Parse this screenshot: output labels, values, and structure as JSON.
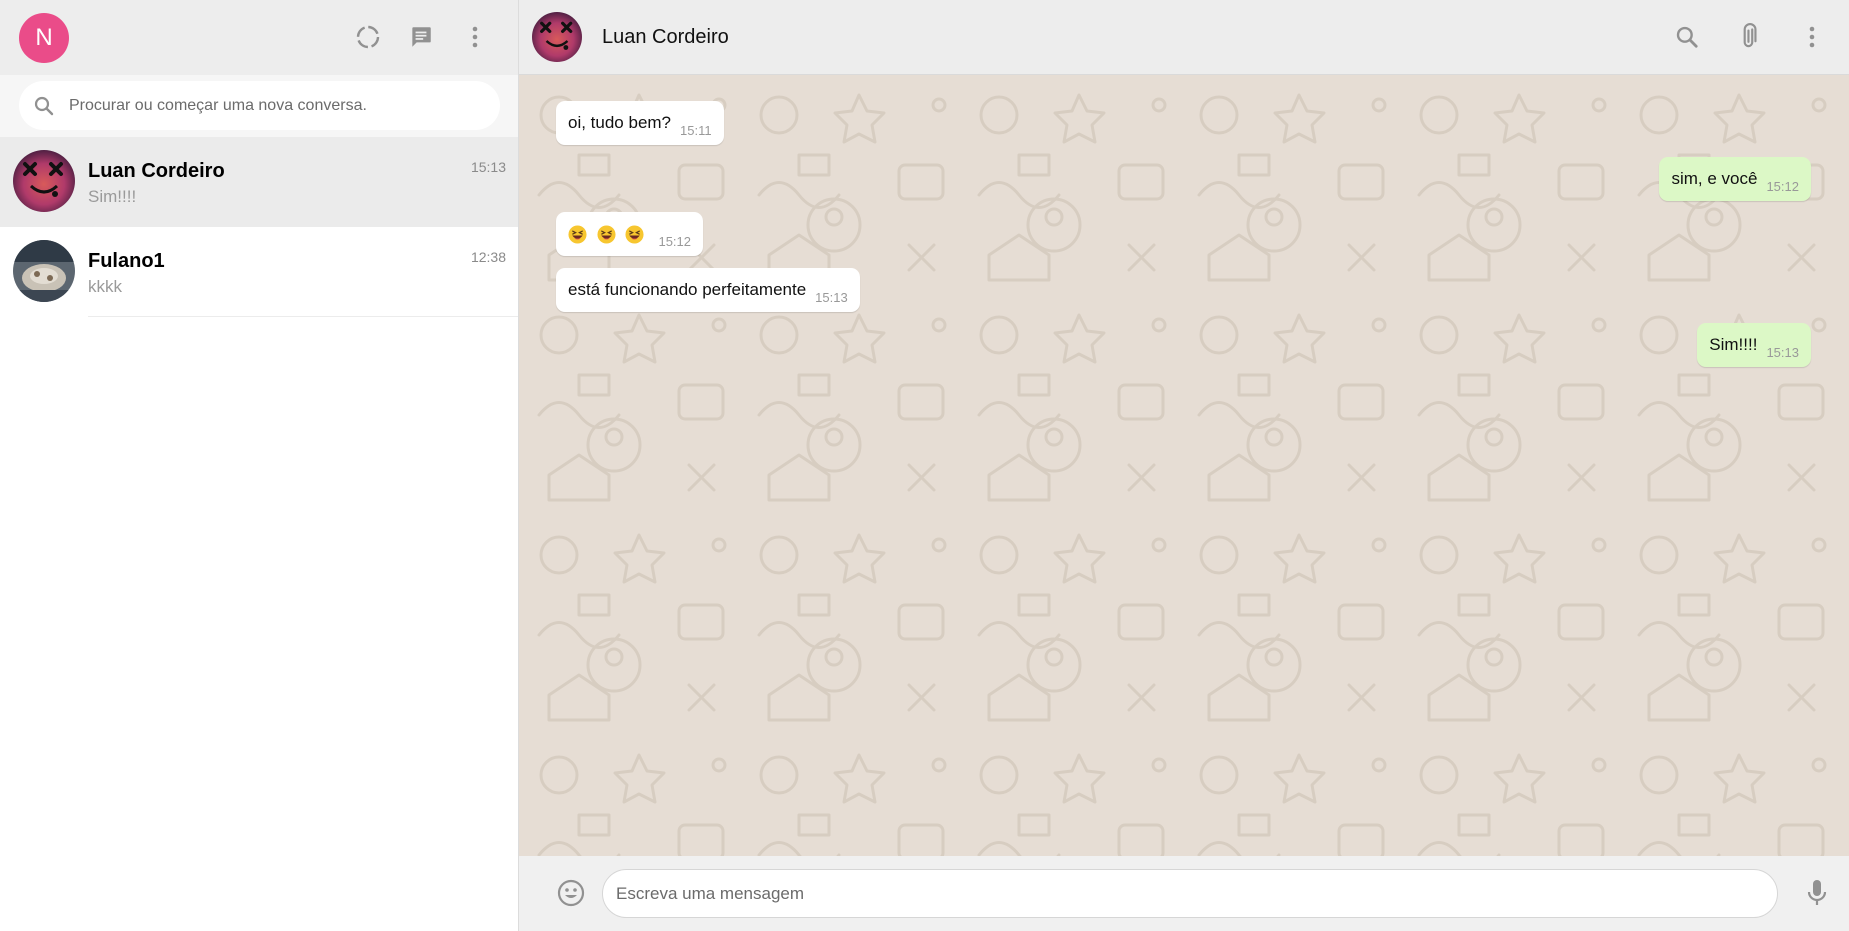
{
  "app": {
    "user_initial": "N",
    "colors": {
      "user_avatar": "#ea4c89",
      "incoming_bubble": "#ffffff",
      "outgoing_bubble": "#dcf8c6",
      "chat_background": "#e6ddd4",
      "header_background": "#ededed"
    }
  },
  "left_header": {
    "icons": [
      "status-icon",
      "new-chat-icon",
      "menu-icon"
    ]
  },
  "search": {
    "placeholder": "Procurar ou começar uma nova conversa."
  },
  "chats": [
    {
      "name": "Luan Cordeiro",
      "time": "15:13",
      "last_message": "Sim!!!!",
      "active": true
    },
    {
      "name": "Fulano1",
      "time": "12:38",
      "last_message": "kkkk",
      "active": false
    }
  ],
  "chat_header": {
    "contact_name": "Luan Cordeiro",
    "icons": [
      "search-icon",
      "attach-icon",
      "menu-icon"
    ]
  },
  "messages": [
    {
      "direction": "in",
      "text": "oi, tudo bem?",
      "time": "15:11"
    },
    {
      "direction": "out",
      "text": "sim, e você",
      "time": "15:12"
    },
    {
      "direction": "in",
      "text": "",
      "emoji": [
        "grinning-squint-face",
        "grinning-squint-face",
        "grinning-squint-face"
      ],
      "time": "15:12"
    },
    {
      "direction": "in",
      "text": "está funcionando perfeitamente",
      "time": "15:13"
    },
    {
      "direction": "out",
      "text": "Sim!!!!",
      "time": "15:13"
    }
  ],
  "composer": {
    "placeholder": "Escreva uma mensagem",
    "icons": [
      "emoji-icon",
      "microphone-icon"
    ]
  }
}
